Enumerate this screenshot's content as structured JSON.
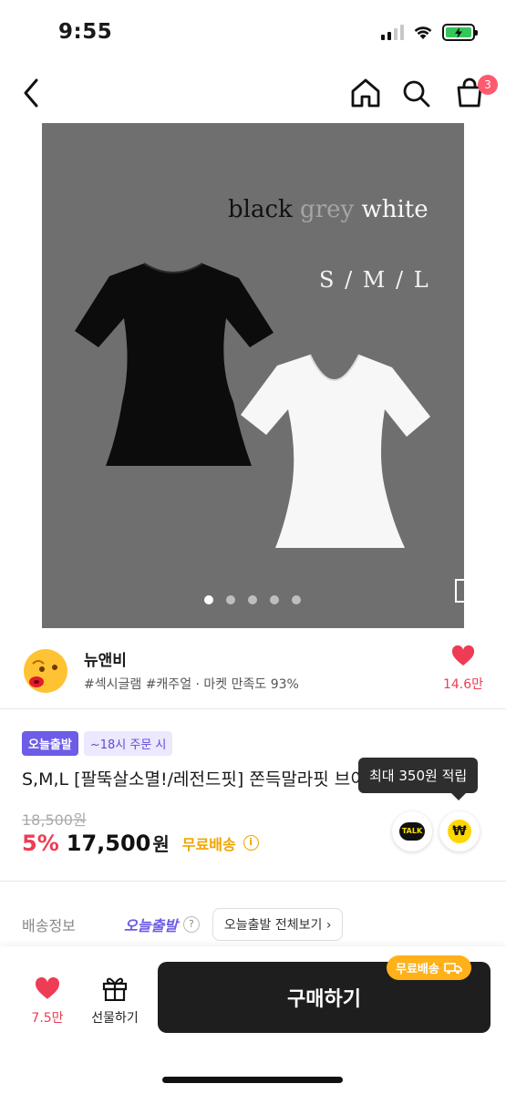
{
  "status_bar": {
    "time": "9:55"
  },
  "nav": {
    "cart_count": "3"
  },
  "product_image": {
    "colors": {
      "black": "black",
      "grey": "grey",
      "white": "white"
    },
    "sizes": "S / M / L",
    "page_index": 1,
    "page_count": 5
  },
  "seller": {
    "name": "뉴앤비",
    "tags": "#섹시글램 #캐주얼 · 마켓 만족도 93%",
    "like_count": "14.6만"
  },
  "product": {
    "badge_today": "오늘출발",
    "badge_time": "~18시 주문 시",
    "title": "S,M,L [팔뚝살소멸!/레전드핏] 쫀득말라핏 브이넥 반팔",
    "tooltip": "최대 350원 적립",
    "original_price": "18,500원",
    "discount": "5%",
    "price": "17,500",
    "currency": "원",
    "free_shipping": "무료배송",
    "talk_label": "TALK",
    "pay_symbol": "₩"
  },
  "shipping": {
    "label": "배송정보",
    "today": "오늘출발",
    "help": "?",
    "view_all": "오늘출발 전체보기"
  },
  "bottom_bar": {
    "like_count": "7.5만",
    "gift_label": "선물하기",
    "buy_label": "구매하기",
    "free_shipping_pill": "무료배송"
  },
  "colors": {
    "accent_purple": "#6c5ce7",
    "sale_red": "#ee3c55",
    "free_ship_orange": "#f0a500",
    "buy_button": "#1e1e1e"
  }
}
